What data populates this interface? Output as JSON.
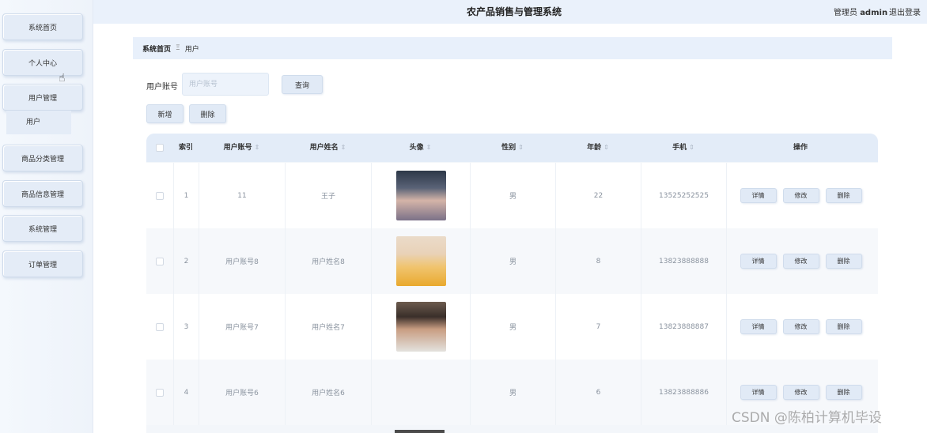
{
  "header": {
    "title": "农产品销售与管理系统",
    "user_role": "管理员",
    "user_name": "admin",
    "logout": "退出登录"
  },
  "sidebar": {
    "items": [
      {
        "label": "系统首页"
      },
      {
        "label": "个人中心"
      },
      {
        "label": "用户管理"
      },
      {
        "label": "商品分类管理"
      },
      {
        "label": "商品信息管理"
      },
      {
        "label": "系统管理"
      },
      {
        "label": "订单管理"
      }
    ],
    "sub_item": "用户"
  },
  "breadcrumb": {
    "home": "系统首页",
    "separator": "Ξ",
    "current": "用户"
  },
  "search": {
    "label": "用户账号",
    "placeholder": "用户账号",
    "query_button": "查询"
  },
  "actions": {
    "add": "新增",
    "delete": "删除"
  },
  "table": {
    "columns": [
      "索引",
      "用户账号",
      "用户姓名",
      "头像",
      "性别",
      "年龄",
      "手机",
      "操作"
    ],
    "sort_icon": "⇕",
    "rows": [
      {
        "index": "1",
        "account": "11",
        "name": "王子",
        "gender": "男",
        "age": "22",
        "phone": "13525252525"
      },
      {
        "index": "2",
        "account": "用户账号8",
        "name": "用户姓名8",
        "gender": "男",
        "age": "8",
        "phone": "13823888888"
      },
      {
        "index": "3",
        "account": "用户账号7",
        "name": "用户姓名7",
        "gender": "男",
        "age": "7",
        "phone": "13823888887"
      },
      {
        "index": "4",
        "account": "用户账号6",
        "name": "用户姓名6",
        "gender": "男",
        "age": "6",
        "phone": "13823888886"
      }
    ],
    "row_actions": {
      "detail": "详情",
      "edit": "修改",
      "delete": "删除"
    }
  },
  "watermark": "CSDN @陈柏计算机毕设"
}
